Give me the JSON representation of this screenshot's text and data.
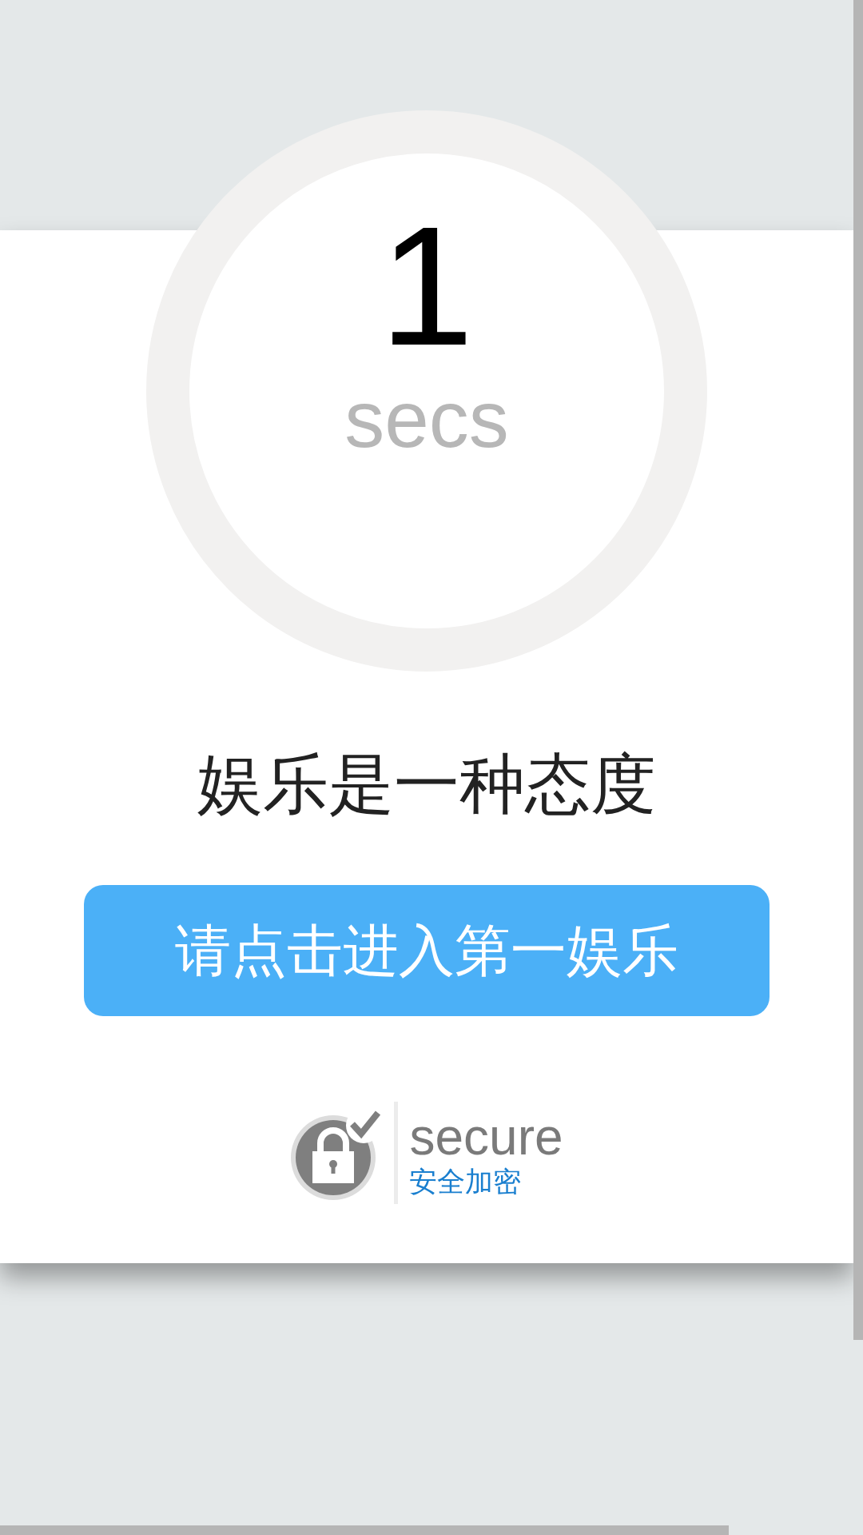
{
  "countdown": {
    "number": "1",
    "unit": "secs"
  },
  "title": "娱乐是一种态度",
  "enter_button": {
    "label": "请点击进入第一娱乐"
  },
  "secure_badge": {
    "word": "secure",
    "caption": "安全加密"
  }
}
